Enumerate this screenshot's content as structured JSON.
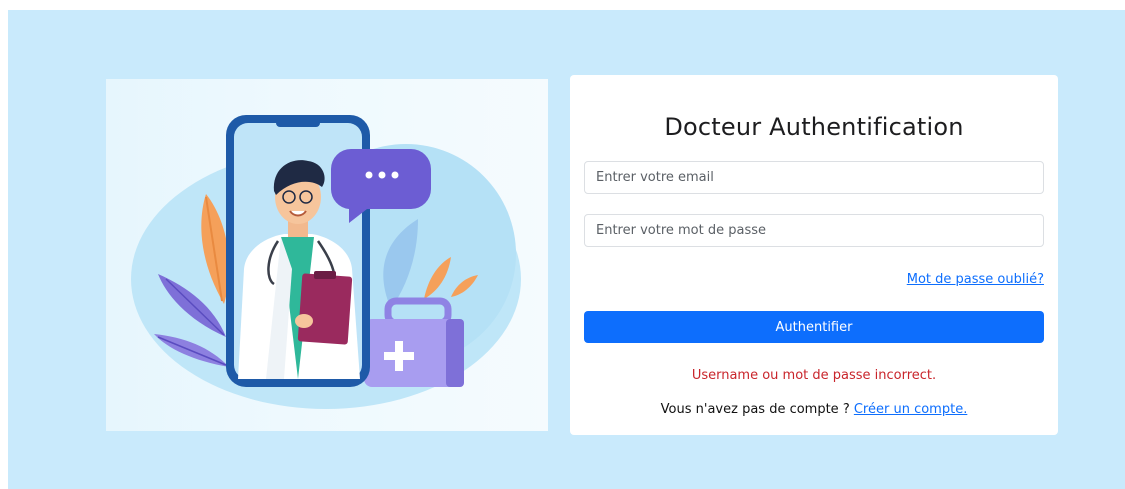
{
  "login": {
    "title": "Docteur Authentification",
    "email_placeholder": "Entrer votre email",
    "password_placeholder": "Entrer votre mot de passe",
    "forgot_label": "Mot de passe oublié?",
    "submit_label": "Authentifier",
    "error_message": "Username ou mot de passe incorrect.",
    "signup_prompt": "Vous n'avez pas de compte ? ",
    "signup_link": "Créer un compte."
  },
  "illustration": {
    "subject": "doctor-on-phone-icon"
  },
  "colors": {
    "page_background": "#c9eafc",
    "primary": "#0d6efd",
    "error": "#c9252b"
  }
}
